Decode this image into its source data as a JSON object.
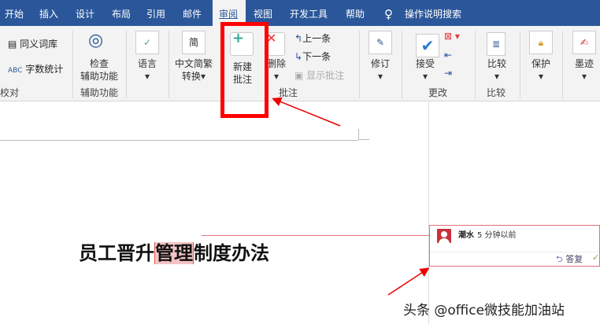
{
  "tabs": [
    "开始",
    "插入",
    "设计",
    "布局",
    "引用",
    "邮件",
    "审阅",
    "视图",
    "开发工具",
    "帮助"
  ],
  "search": "操作说明搜索",
  "ribbon": {
    "thesaurus": "同义词库",
    "wordcount": "字数统计",
    "group_proofing": "校对",
    "check_access_1": "检查",
    "check_access_2": "辅助功能",
    "group_access": "辅助功能",
    "language": "语言",
    "convert_1": "中文简繁",
    "convert_2": "转换",
    "new_comment_1": "新建",
    "new_comment_2": "批注",
    "delete": "删除",
    "prev": "上一条",
    "next": "下一条",
    "show_comments": "显示批注",
    "group_comments": "批注",
    "track": "修订",
    "accept": "接受",
    "group_changes": "更改",
    "compare": "比较",
    "group_compare": "比较",
    "protect": "保护",
    "ink": "墨迹"
  },
  "document": {
    "title_pre": "员工晋升",
    "title_hl": "管理",
    "title_post": "制度办法"
  },
  "comment": {
    "author": "潮水",
    "time": "5 分钟以前",
    "reply": "答复"
  },
  "watermark": "头条 @office微技能加油站"
}
